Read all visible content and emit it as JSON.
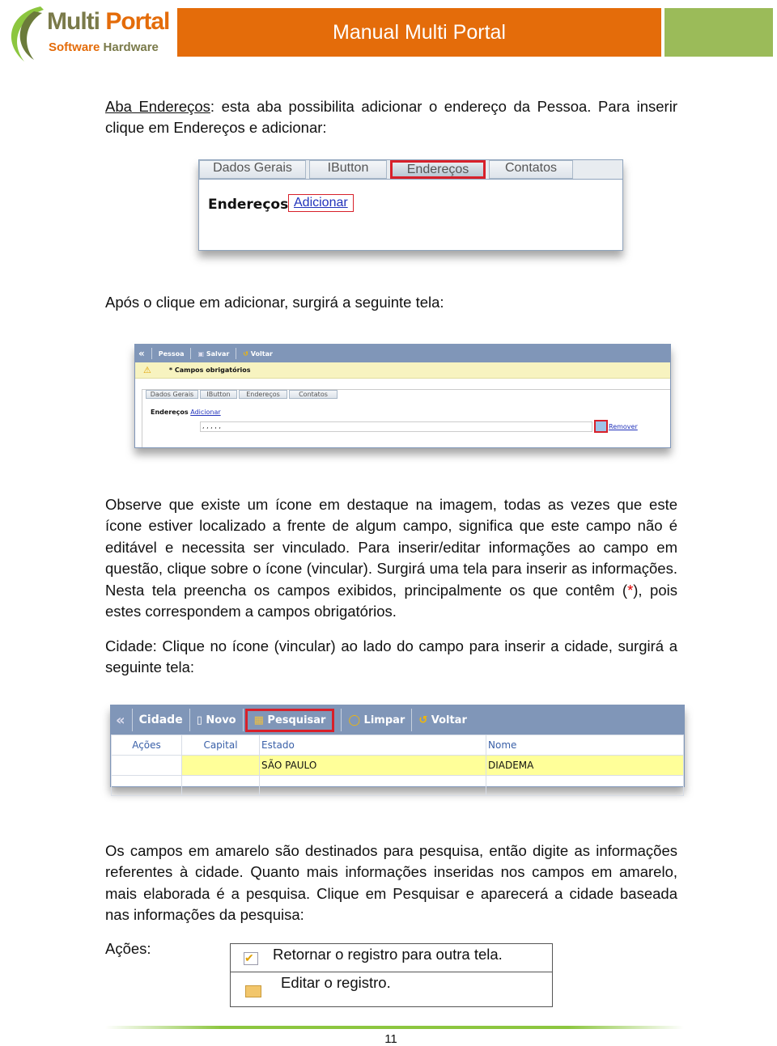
{
  "header": {
    "logo_text_top": "Multi Portal",
    "logo_text_bottom": "Software Hardware",
    "title": "Manual Multi Portal",
    "colors": {
      "orange": "#e46c0a",
      "green": "#9bbb59"
    }
  },
  "para1": {
    "link": "Aba Endereços",
    "text": ": esta aba possibilita adicionar o endereço da Pessoa. Para inserir clique em Endereços e adicionar:"
  },
  "shot1": {
    "tabs": [
      "Dados Gerais",
      "IButton",
      "Endereços",
      "Contatos"
    ],
    "label": "Endereços",
    "link": "Adicionar"
  },
  "para2": "Após o clique em adicionar, surgirá a seguinte tela:",
  "shot2": {
    "toolbar": [
      "Pessoa",
      "Salvar",
      "Voltar"
    ],
    "warning": "* Campos obrigatórios",
    "tabs": [
      "Dados Gerais",
      "IButton",
      "Endereços",
      "Contatos"
    ],
    "label": "Endereços",
    "link": "Adicionar",
    "field_value": ", , , , ,",
    "remove": "Remover"
  },
  "para3": {
    "before": "Observe que existe um ícone em destaque na imagem, todas as vezes que este ícone estiver localizado a frente de algum campo, significa que este campo não é editável e necessita ser vinculado. Para inserir/editar informações ao campo em questão, clique sobre o ícone (vincular). Surgirá uma tela para inserir as informações. Nesta tela preencha os campos exibidos, principalmente os que contêm (",
    "star": "*",
    "after": "), pois estes correspondem a campos obrigatórios."
  },
  "para4": "Cidade: Clique no ícone (vincular) ao lado do campo para inserir a cidade, surgirá a seguinte tela:",
  "shot3": {
    "toolbar": [
      "Cidade",
      "Novo",
      "Pesquisar",
      "Limpar",
      "Voltar"
    ],
    "columns": [
      "Ações",
      "Capital",
      "Estado",
      "Nome"
    ],
    "rows": [
      [
        "",
        "",
        "SÃO PAULO",
        "DIADEMA"
      ]
    ]
  },
  "para5": "Os campos em amarelo são destinados para pesquisa, então digite as informações referentes à cidade. Quanto mais informações inseridas nos campos em amarelo, mais elaborada é a pesquisa. Clique em Pesquisar e aparecerá a cidade baseada nas informações da pesquisa:",
  "actions": {
    "label": "Ações:",
    "items": [
      {
        "icon": "checkbox-icon",
        "text": "Retornar o registro para outra tela."
      },
      {
        "icon": "folder-icon",
        "text": "Editar o registro."
      }
    ]
  },
  "footer": {
    "page": "11"
  }
}
